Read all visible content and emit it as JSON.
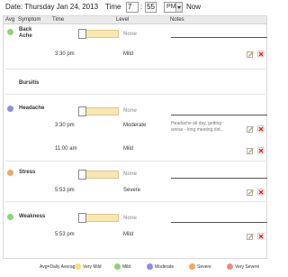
{
  "header": {
    "date_label": "Date: Thursday Jan 24, 2013",
    "time_label": "Time",
    "hour": "7",
    "minute": "55",
    "ampm": "PM",
    "now_label": "Now"
  },
  "table_headers": {
    "avg": "Avg",
    "symptom": "Symptom",
    "time": "Time",
    "level": "Level",
    "notes": "Notes"
  },
  "symptoms": [
    {
      "name_line1": "Back",
      "name_line2": "Ache",
      "avg_color": "#8fd27b",
      "slider_label": "None",
      "entries": [
        {
          "time": "3:30 pm",
          "level": "Mild",
          "note": ""
        }
      ]
    },
    {
      "name_line1": "Bursitis",
      "name_line2": "",
      "avg_color": "",
      "slider_label": "",
      "entries": []
    },
    {
      "name_line1": "Headache",
      "name_line2": "",
      "avg_color": "#8c8ce0",
      "slider_label": "None",
      "entries": [
        {
          "time": "3:30 pm",
          "level": "Moderate",
          "note_line1": "Headache all day, getting",
          "note_line2": "worse - long meeting did..."
        },
        {
          "time": "11:00 am",
          "level": "Mild",
          "note": ""
        }
      ]
    },
    {
      "name_line1": "Stress",
      "name_line2": "",
      "avg_color": "#f5a462",
      "slider_label": "None",
      "entries": [
        {
          "time": "5:53 pm",
          "level": "Severe",
          "note": ""
        }
      ]
    },
    {
      "name_line1": "Weakness",
      "name_line2": "",
      "avg_color": "#8fd27b",
      "slider_label": "None",
      "entries": [
        {
          "time": "5:53 pm",
          "level": "Mild",
          "note": ""
        }
      ]
    }
  ],
  "legend": {
    "avg_label": "Avg=Daily Average",
    "items": [
      {
        "label": "Very Mild",
        "color": "#f5e27a"
      },
      {
        "label": "Mild",
        "color": "#8fd27b"
      },
      {
        "label": "Moderate",
        "color": "#8c8ce0"
      },
      {
        "label": "Severe",
        "color": "#f5a462"
      },
      {
        "label": "Very Severe",
        "color": "#f08a8a"
      }
    ]
  }
}
